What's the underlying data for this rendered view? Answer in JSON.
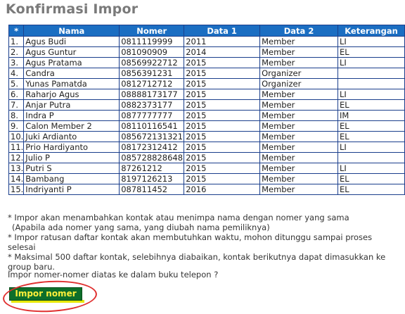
{
  "title": "Konfirmasi Impor",
  "table": {
    "headers": [
      "*",
      "Nama",
      "Nomer",
      "Data 1",
      "Data 2",
      "Keterangan"
    ],
    "rows": [
      [
        "1.",
        "Agus Budi",
        "0811119999",
        "2011",
        "Member",
        "LI"
      ],
      [
        "2.",
        "Agus Guntur",
        "081090909",
        "2014",
        "Member",
        "EL"
      ],
      [
        "3.",
        "Agus Pratama",
        "08569922712",
        "2015",
        "Member",
        "LI"
      ],
      [
        "4.",
        "Candra",
        "0856391231",
        "2015",
        "Organizer",
        ""
      ],
      [
        "5.",
        "Yunas Pamatda",
        "0812712712",
        "2015",
        "Organizer",
        ""
      ],
      [
        "6.",
        "Raharjo Agus",
        "08888173177",
        "2015",
        "Member",
        "LI"
      ],
      [
        "7.",
        "Anjar Putra",
        "0882373177",
        "2015",
        "Member",
        "EL"
      ],
      [
        "8.",
        "Indra P",
        "0877777777",
        "2015",
        "Member",
        "IM"
      ],
      [
        "9.",
        "Calon Member 2",
        "08110116541",
        "2015",
        "Member",
        "EL"
      ],
      [
        "10.",
        "Juki Ardianto",
        "085672131321",
        "2015",
        "Member",
        "EL"
      ],
      [
        "11.",
        "Prio Hardiyanto",
        "08172312412",
        "2015",
        "Member",
        "LI"
      ],
      [
        "12.",
        "Julio P",
        "085728828648",
        "2015",
        "Member",
        ""
      ],
      [
        "13.",
        "Putri S",
        "87261212",
        "2015",
        "Member",
        "LI"
      ],
      [
        "14.",
        "Bambang",
        "8197126213",
        "2015",
        "Member",
        "EL"
      ],
      [
        "15.",
        "Indriyanti P",
        "087811452",
        "2016",
        "Member",
        "EL"
      ]
    ]
  },
  "notes": [
    "* Impor akan menambahkan kontak atau menimpa nama dengan nomer yang sama",
    "(Apabila ada nomer yang sama, yang diubah nama pemiliknya)",
    "* Impor ratusan daftar kontak akan membutuhkan waktu, mohon ditunggu sampai proses selesai",
    "* Maksimal 500 daftar kontak, selebihnya diabaikan, kontak berikutnya dapat dimasukkan ke group baru."
  ],
  "question": "Impor nomer-nomer diatas ke dalam buku telepon ?",
  "button": {
    "label": "Impor nomer"
  },
  "colors": {
    "header_bg": "#1b6ec2",
    "border": "#1a3e8c",
    "button_bg": "#0d6e2a",
    "button_text": "#ffef3a",
    "annotation_circle": "#e03030"
  }
}
